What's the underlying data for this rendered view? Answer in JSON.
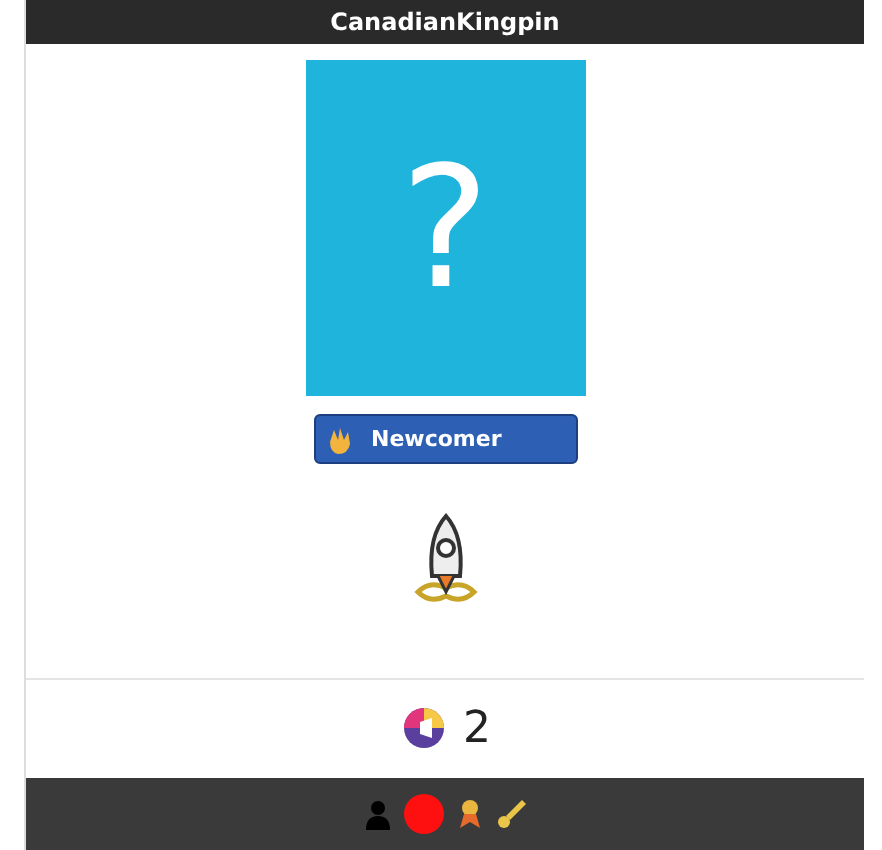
{
  "profile": {
    "username": "CanadianKingpin",
    "avatar_glyph": "?",
    "badge": "Newcomer",
    "reaction_count": "2"
  },
  "footer": {
    "status": {
      "color": "#ff1010"
    }
  }
}
